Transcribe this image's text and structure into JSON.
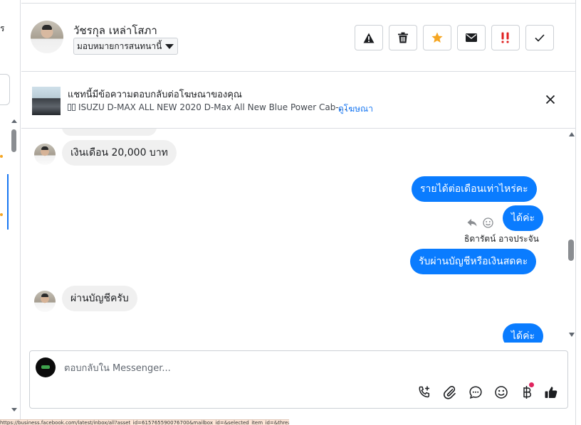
{
  "left_panel": {
    "cut_text": "ร"
  },
  "header": {
    "contact_name": "วัชรกุล เหล่าโสภา",
    "assign_label": "มอบหมายการสนทนานี้",
    "actions": [
      {
        "icon": "warning-icon",
        "color": "#1c1e21"
      },
      {
        "icon": "trash-icon",
        "color": "#1c1e21"
      },
      {
        "icon": "star-icon",
        "color": "#f5a623"
      },
      {
        "icon": "envelope-icon",
        "color": "#1c1e21"
      },
      {
        "icon": "urgent-icon",
        "color": "#e02020"
      },
      {
        "icon": "check-icon",
        "color": "#1c1e21"
      }
    ]
  },
  "ad_banner": {
    "title": "แชทนี้มีข้อความตอบกลับต่อโฆษณาของคุณ",
    "subtitle": "ISUZU D-MAX ALL NEW 2020 D-Max All New Blue Power Cab-...",
    "link": "ดูโฆษณา"
  },
  "thread": {
    "messages": [
      {
        "dir": "in",
        "text": "เงินเดือน 20,000 บาท"
      },
      {
        "dir": "out",
        "text": "รายได้ต่อเดือนเท่าไหร่คะ"
      },
      {
        "dir": "out",
        "text": "ได้ค่ะ"
      },
      {
        "dir": "note",
        "text": "ธิดารัตน์ อาจประจัน"
      },
      {
        "dir": "out",
        "text": "รับผ่านบัญชีหรือเงินสดคะ"
      },
      {
        "dir": "in",
        "text": "ผ่านบัญชีครับ"
      },
      {
        "dir": "out",
        "text": "ได้ค่ะ"
      }
    ]
  },
  "composer": {
    "placeholder": "ตอบกลับใน Messenger...",
    "tools": [
      "call-add-icon",
      "paperclip-icon",
      "chat-bubble-icon",
      "emoji-icon",
      "baht-icon",
      "thumbs-up-icon"
    ],
    "accent": "#0a7cff"
  },
  "status_bar": {
    "text": "https://business.facebook.com/latest/inbox/all?asset_id=615765590076700&mailbox_id=&selected_item_id=&thread_type=FB_MESSAGE"
  }
}
